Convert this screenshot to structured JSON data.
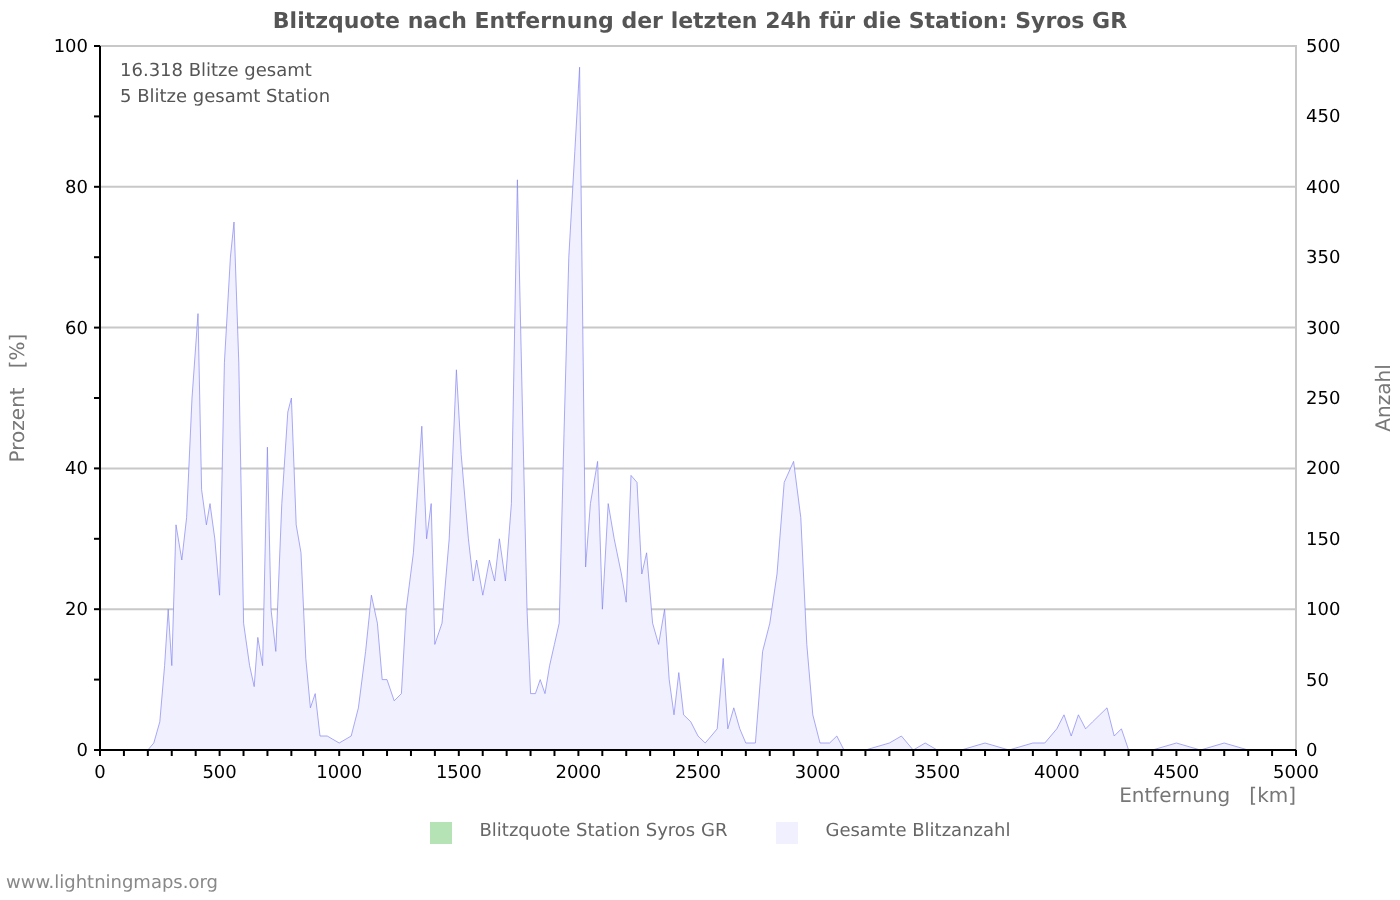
{
  "chart_data": {
    "type": "area",
    "title": "Blitzquote nach Entfernung der letzten 24h für die Station: Syros GR",
    "xlabel": "Entfernung   [km]",
    "ylabel": "Anzahl",
    "y2label": "Prozent   [%]",
    "xlim": [
      0,
      5000
    ],
    "ylim": [
      0,
      500
    ],
    "xticks": [
      0,
      500,
      1000,
      1500,
      2000,
      2500,
      3000,
      3500,
      4000,
      4500,
      5000
    ],
    "yticks": [
      0,
      50,
      100,
      150,
      200,
      250,
      300,
      350,
      400,
      450,
      500
    ],
    "y2ticks": [
      0,
      20,
      40,
      60,
      80,
      100
    ],
    "y2lim": [
      0,
      100
    ],
    "grid": true,
    "x": [
      0,
      200,
      225,
      250,
      270,
      285,
      300,
      318,
      342,
      362,
      385,
      410,
      425,
      445,
      460,
      480,
      500,
      520,
      545,
      560,
      580,
      600,
      625,
      645,
      660,
      680,
      700,
      715,
      735,
      760,
      785,
      800,
      820,
      840,
      860,
      880,
      900,
      920,
      950,
      1000,
      1050,
      1080,
      1110,
      1135,
      1160,
      1180,
      1200,
      1230,
      1260,
      1280,
      1310,
      1345,
      1365,
      1385,
      1400,
      1430,
      1460,
      1490,
      1510,
      1540,
      1560,
      1574,
      1600,
      1628,
      1650,
      1670,
      1695,
      1720,
      1745,
      1765,
      1785,
      1800,
      1820,
      1840,
      1860,
      1880,
      1900,
      1920,
      1940,
      1960,
      1985,
      2005,
      2020,
      2030,
      2050,
      2080,
      2100,
      2125,
      2150,
      2180,
      2200,
      2220,
      2245,
      2265,
      2285,
      2310,
      2335,
      2360,
      2380,
      2400,
      2420,
      2440,
      2470,
      2500,
      2530,
      2555,
      2580,
      2605,
      2625,
      2650,
      2675,
      2700,
      2740,
      2770,
      2800,
      2830,
      2860,
      2900,
      2930,
      2955,
      2980,
      3010,
      3050,
      3080,
      3110,
      3200,
      3300,
      3350,
      3400,
      3450,
      3500,
      3600,
      3700,
      3800,
      3900,
      3950,
      4000,
      4030,
      4060,
      4090,
      4120,
      4150,
      4180,
      4210,
      4240,
      4270,
      4300,
      4400,
      4500,
      4600,
      4700,
      4800,
      5000
    ],
    "series": [
      {
        "name": "Gesamte Blitzanzahl",
        "color": "#f0f0fe",
        "values": [
          0,
          0,
          5,
          20,
          60,
          100,
          60,
          160,
          135,
          165,
          250,
          310,
          185,
          160,
          175,
          150,
          110,
          275,
          350,
          375,
          275,
          90,
          60,
          45,
          80,
          60,
          215,
          100,
          70,
          175,
          240,
          250,
          160,
          140,
          65,
          30,
          40,
          10,
          10,
          5,
          10,
          30,
          70,
          110,
          90,
          50,
          50,
          35,
          40,
          100,
          140,
          230,
          150,
          175,
          75,
          90,
          150,
          270,
          210,
          150,
          120,
          135,
          110,
          135,
          120,
          150,
          120,
          175,
          405,
          250,
          100,
          40,
          40,
          50,
          40,
          60,
          75,
          90,
          225,
          350,
          425,
          485,
          275,
          130,
          175,
          205,
          100,
          175,
          150,
          125,
          105,
          195,
          190,
          125,
          140,
          90,
          75,
          100,
          50,
          25,
          55,
          25,
          20,
          10,
          5,
          10,
          15,
          65,
          15,
          30,
          15,
          5,
          5,
          70,
          90,
          125,
          190,
          205,
          165,
          75,
          25,
          5,
          5,
          10,
          0,
          0,
          5,
          10,
          0,
          5,
          0,
          0,
          5,
          0,
          5,
          5,
          15,
          25,
          10,
          25,
          15,
          20,
          25,
          30,
          10,
          15,
          0,
          0,
          5,
          0,
          5,
          0,
          0
        ]
      }
    ],
    "annotations": [
      "16.318 Blitze gesamt",
      "5 Blitze gesamt Station"
    ]
  },
  "legend": [
    {
      "label": "Blitzquote Station Syros GR",
      "color": "#b6e3b6"
    }
  ],
  "footer": "www.lightningmaps.org"
}
